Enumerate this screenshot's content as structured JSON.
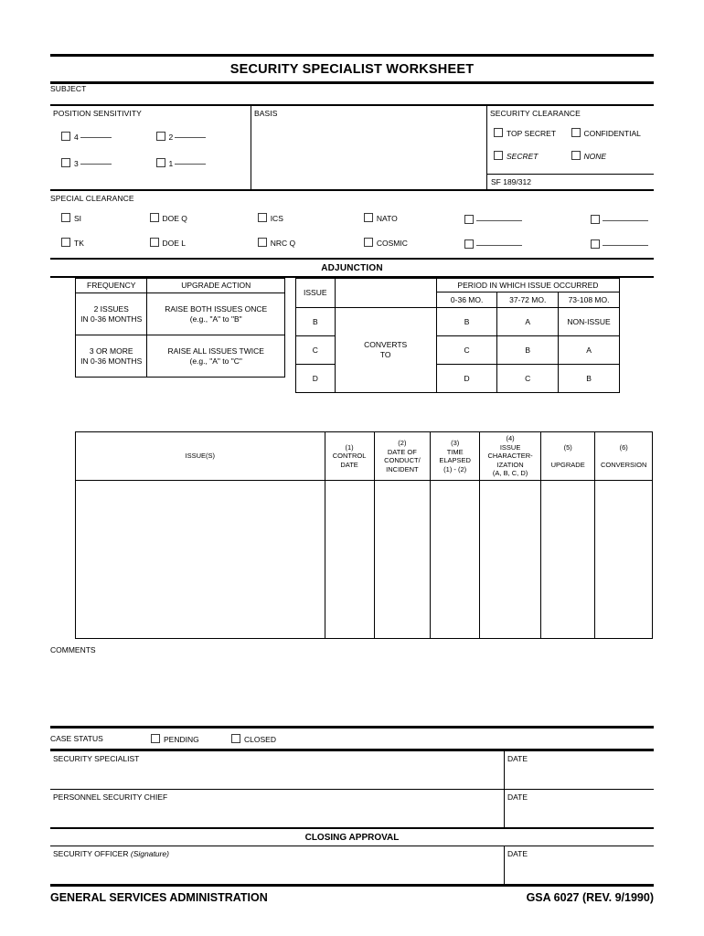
{
  "form": {
    "title": "SECURITY SPECIALIST WORKSHEET",
    "subject_label": "SUBJECT",
    "adjunction_heading": "ADJUNCTION",
    "closing_approval_heading": "CLOSING APPROVAL",
    "comments_label": "COMMENTS"
  },
  "position_sensitivity": {
    "label": "POSITION SENSITIVITY",
    "options": [
      {
        "label": "4"
      },
      {
        "label": "2"
      },
      {
        "label": "3"
      },
      {
        "label": "1"
      }
    ]
  },
  "basis": {
    "label": "BASIS",
    "value": ""
  },
  "security_clearance": {
    "label": "SECURITY CLEARANCE",
    "options": [
      {
        "label": "TOP SECRET",
        "italic": false
      },
      {
        "label": "CONFIDENTIAL",
        "italic": false
      },
      {
        "label": "SECRET",
        "italic": true
      },
      {
        "label": "NONE",
        "italic": true
      }
    ],
    "footer": "SF 189/312"
  },
  "special_clearance": {
    "label": "SPECIAL CLEARANCE",
    "row1": [
      "SI",
      "DOE Q",
      "ICS",
      "NATO"
    ],
    "row2": [
      "TK",
      "DOE L",
      "NRC Q",
      "COSMIC"
    ],
    "blank_options_count": 4
  },
  "frequency_table": {
    "headers": [
      "FREQUENCY",
      "UPGRADE ACTION"
    ],
    "rows": [
      {
        "frequency_line1": "2 ISSUES",
        "frequency_line2": "IN 0-36 MONTHS",
        "action_line1": "RAISE BOTH ISSUES ONCE",
        "action_line2": "(e.g., \"A\" to \"B\""
      },
      {
        "frequency_line1": "3 OR MORE",
        "frequency_line2": "IN 0-36 MONTHS",
        "action_line1": "RAISE ALL ISSUES TWICE",
        "action_line2": "(e.g., \"A\" to \"C\""
      }
    ]
  },
  "conversion_table": {
    "issue_header": "ISSUE",
    "converts_to_line1": "CONVERTS",
    "converts_to_line2": "TO",
    "period_header": "PERIOD IN WHICH ISSUE OCCURRED",
    "period_columns": [
      "0-36 MO.",
      "37-72 MO.",
      "73-108 MO."
    ],
    "rows": [
      {
        "issue": "B",
        "values": [
          "B",
          "A",
          "NON-ISSUE"
        ]
      },
      {
        "issue": "C",
        "values": [
          "C",
          "B",
          "A"
        ]
      },
      {
        "issue": "D",
        "values": [
          "D",
          "C",
          "B"
        ]
      }
    ]
  },
  "issues_table": {
    "issues_header": "ISSUE(S)",
    "columns": [
      {
        "num": "(1)",
        "lines": [
          "CONTROL",
          "DATE"
        ]
      },
      {
        "num": "(2)",
        "lines": [
          "DATE OF",
          "CONDUCT/",
          "INCIDENT"
        ]
      },
      {
        "num": "(3)",
        "lines": [
          "TIME",
          "ELAPSED",
          "(1) - (2)"
        ]
      },
      {
        "num": "(4)",
        "lines": [
          "ISSUE",
          "CHARACTER-",
          "IZATION",
          "(A, B, C, D)"
        ]
      },
      {
        "num": "(5)",
        "lines": [
          "UPGRADE"
        ]
      },
      {
        "num": "(6)",
        "lines": [
          "CONVERSION"
        ]
      }
    ]
  },
  "case_status": {
    "label": "CASE STATUS",
    "options": [
      "PENDING",
      "CLOSED"
    ]
  },
  "signatures": [
    {
      "name_label": "SECURITY SPECIALIST",
      "date_label": "DATE"
    },
    {
      "name_label": "PERSONNEL SECURITY CHIEF",
      "date_label": "DATE"
    }
  ],
  "closing_signature": {
    "name_label": "SECURITY OFFICER",
    "name_label_italic": "(Signature)",
    "date_label": "DATE"
  },
  "footer": {
    "agency": "GENERAL SERVICES ADMINISTRATION",
    "form_number": "GSA 6027 (REV. 9/1990)"
  }
}
